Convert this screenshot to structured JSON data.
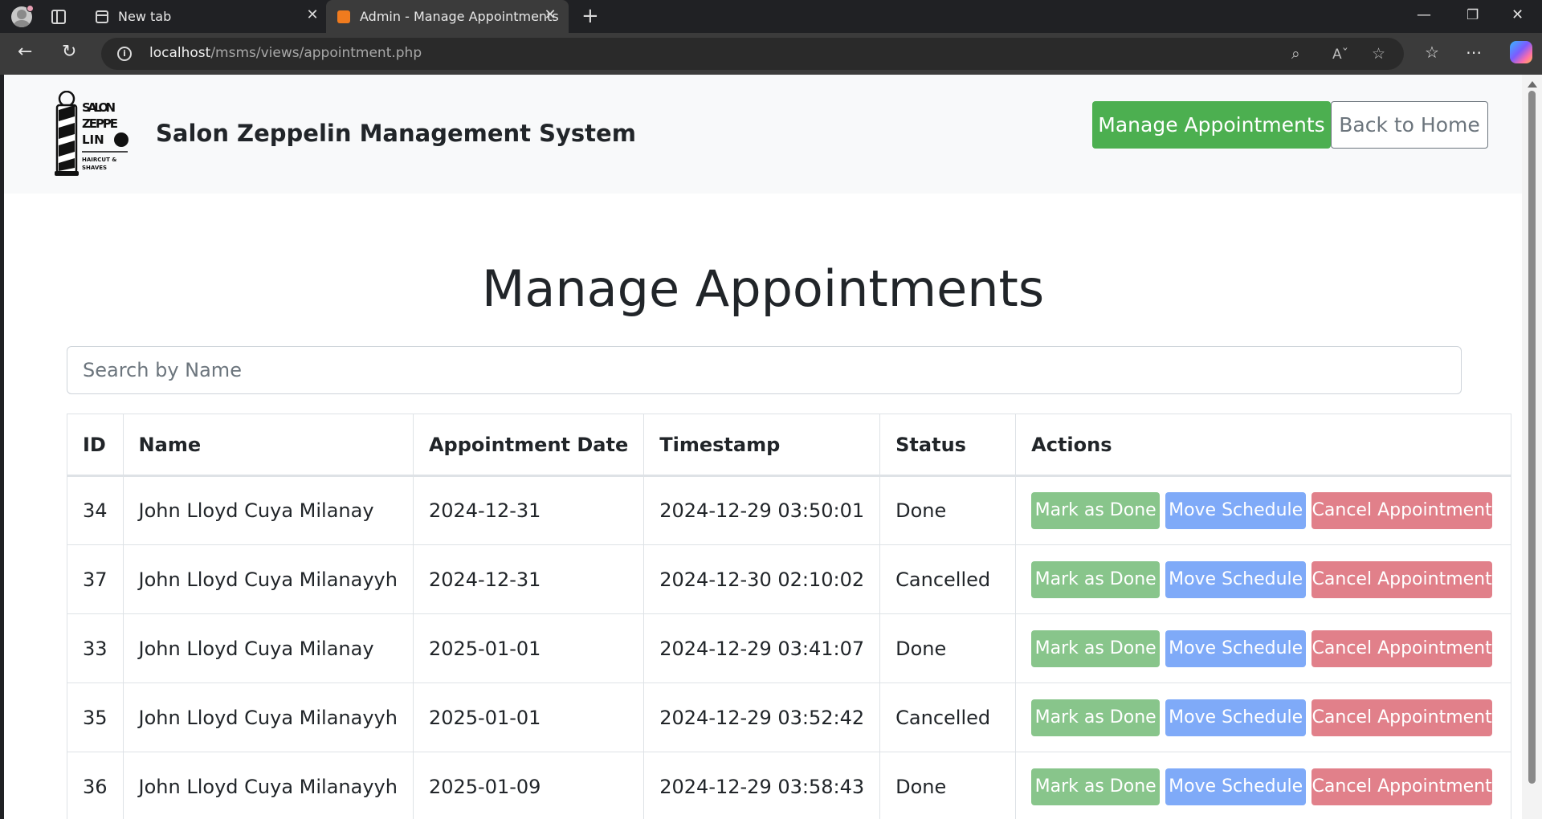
{
  "browser": {
    "tabs": [
      {
        "title": "New tab"
      },
      {
        "title": "Admin - Manage Appointments"
      }
    ],
    "url_host": "localhost",
    "url_path": "/msms/views/appointment.php"
  },
  "header": {
    "logo_text": "SALON ZEPPE LIN HAIRCUT & SHAVES",
    "brand": "Salon Zeppelin Management System",
    "nav": {
      "manage_label": "Manage Appointments",
      "home_label": "Back to Home"
    }
  },
  "main": {
    "title": "Manage Appointments",
    "search_placeholder": "Search by Name",
    "table": {
      "columns": [
        "ID",
        "Name",
        "Appointment Date",
        "Timestamp",
        "Status",
        "Actions"
      ],
      "action_labels": {
        "done": "Mark as Done",
        "move": "Move Schedule",
        "cancel": "Cancel Appointment"
      },
      "rows": [
        {
          "id": "34",
          "name": "John Lloyd Cuya Milanay",
          "date": "2024-12-31",
          "timestamp": "2024-12-29 03:50:01",
          "status": "Done"
        },
        {
          "id": "37",
          "name": "John Lloyd Cuya Milanayyh",
          "date": "2024-12-31",
          "timestamp": "2024-12-30 02:10:02",
          "status": "Cancelled"
        },
        {
          "id": "33",
          "name": "John Lloyd Cuya Milanay",
          "date": "2025-01-01",
          "timestamp": "2024-12-29 03:41:07",
          "status": "Done"
        },
        {
          "id": "35",
          "name": "John Lloyd Cuya Milanayyh",
          "date": "2025-01-01",
          "timestamp": "2024-12-29 03:52:42",
          "status": "Cancelled"
        },
        {
          "id": "36",
          "name": "John Lloyd Cuya Milanayyh",
          "date": "2025-01-09",
          "timestamp": "2024-12-29 03:58:43",
          "status": "Done"
        }
      ]
    }
  },
  "colors": {
    "manage_button": "#4caf50",
    "done_button": "#88c58b",
    "move_button": "#7faaf8",
    "cancel_button": "#e1808a",
    "header_bg": "#f8f9fa"
  },
  "icons": [
    "profile-icon",
    "tab-actions-icon",
    "new-tab-icon",
    "back-icon",
    "refresh-icon",
    "site-info-icon",
    "zoom-icon",
    "read-aloud-icon",
    "favorite-icon",
    "favorites-icon",
    "more-icon",
    "copilot-icon"
  ]
}
